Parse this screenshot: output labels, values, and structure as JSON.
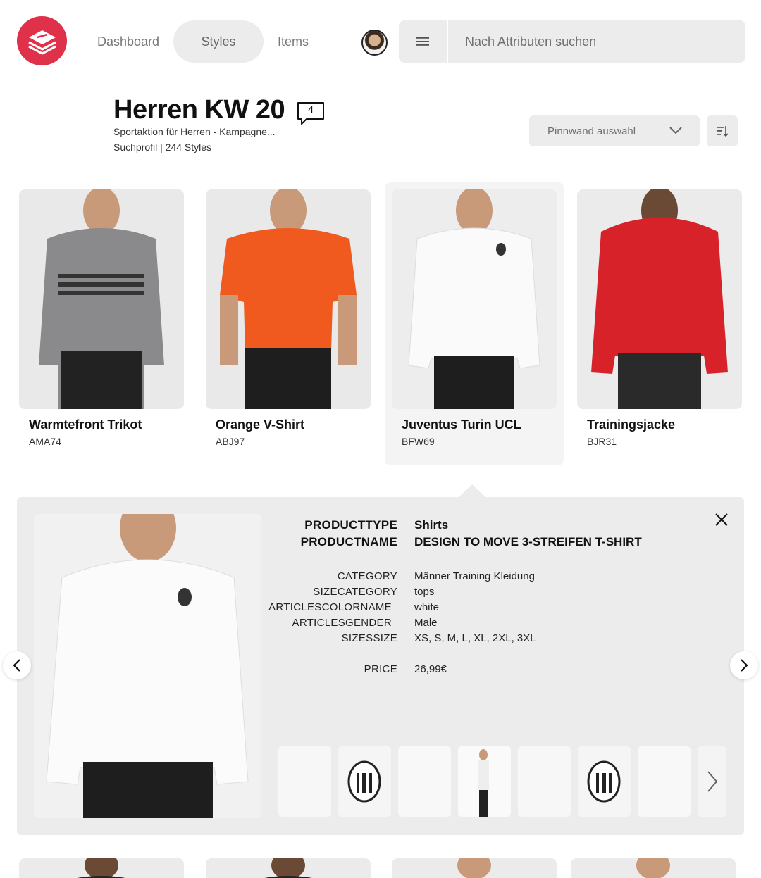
{
  "nav": {
    "items": [
      {
        "label": "Dashboard"
      },
      {
        "label": "Styles"
      },
      {
        "label": "Items"
      }
    ],
    "active": "Styles"
  },
  "search": {
    "placeholder": "Nach Attributen suchen"
  },
  "board": {
    "title": "Herren KW 20",
    "comment_count": "4",
    "subtitle": "Sportaktion für Herren - Kampagne...",
    "meta": "Suchprofil | 244 Styles",
    "pin_select_label": "Pinnwand auswahl"
  },
  "products": [
    {
      "name": "Warmtefront Trikot",
      "code": "AMA74",
      "color": "#8a8a8d"
    },
    {
      "name": "Orange V-Shirt",
      "code": "ABJ97",
      "color": "#f05a1e"
    },
    {
      "name": "Juventus Turin UCL",
      "code": "BFW69",
      "color": "#f4f4f4"
    },
    {
      "name": "Trainingsjacke",
      "code": "BJR31",
      "color": "#d8222a"
    }
  ],
  "detail": {
    "primary": [
      {
        "key": "PRODUCTTYPE",
        "value": "Shirts"
      },
      {
        "key": "PRODUCTNAME",
        "value": "DESIGN TO MOVE 3-STREIFEN T-SHIRT"
      }
    ],
    "attributes": [
      {
        "key": "CATEGORY",
        "value": "Männer Training Kleidung"
      },
      {
        "key": "SIZECATEGORY",
        "value": "tops"
      },
      {
        "key": "ARTICLESCOLORNAME",
        "value": "white"
      },
      {
        "key": "ARTICLESGENDER",
        "value": "Male"
      },
      {
        "key": "SIZESSIZE",
        "value": "XS, S, M, L, XL, 2XL, 3XL"
      }
    ],
    "price": {
      "key": "PRICE",
      "value": "26,99€"
    }
  },
  "colors": {
    "brand": "#e0314b",
    "panel": "#ececec"
  }
}
